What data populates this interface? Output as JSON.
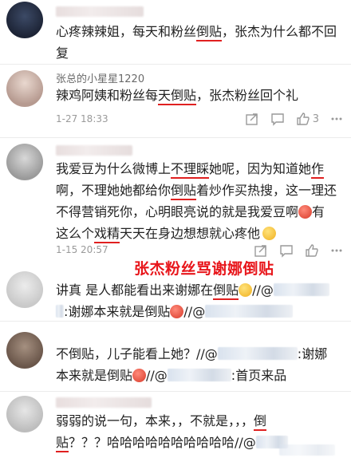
{
  "comments": [
    {
      "author": "",
      "text_parts": [
        "心疼辣辣姐，每天和粉丝",
        "倒贴",
        "，张杰为什么都不回复"
      ],
      "time": "",
      "like_count": ""
    },
    {
      "author": "张总的小星星1220",
      "text_parts": [
        "辣鸡阿姨和粉丝每",
        "天倒贴",
        "，张杰粉丝回个礼"
      ],
      "time": "1-27 18:33",
      "like_count": "3"
    },
    {
      "author": "",
      "text": "我爱豆为什么微博上不理睬她呢，因为知道她作啊，不理她她都给你倒贴着炒作买热搜，这一理还不得营销死你，心明眼亮说的就是我爱豆啊",
      "line1": [
        "我爱豆为什么微博上",
        "不理睬",
        "她呢，因为知道她",
        "作"
      ],
      "line2": [
        "啊，不理她她都给你",
        "倒贴",
        "着炒作买热搜，这一理还"
      ],
      "line3": [
        "不得营销死你，心明眼亮说的就是我爱豆啊",
        "有"
      ],
      "line4": [
        "这么个",
        "戏精",
        "天天在身边想想就心疼他"
      ],
      "time": "1-15 20:57",
      "like_count": ""
    }
  ],
  "headline": "张杰粉丝骂谢娜倒贴",
  "replies": [
    {
      "line1": [
        "讲真 是人都能看出来谢娜在",
        "倒贴",
        "//@"
      ],
      "line2": [
        ":谢娜本来就是倒贴",
        "//@"
      ]
    },
    {
      "line1": [
        "不倒贴，儿子能看上她？//@",
        ":谢娜"
      ],
      "line2": [
        "本来就是倒贴",
        "//@",
        ":首页来品"
      ]
    },
    {
      "line1": [
        "弱弱的说一句，本来，，不就是，，，",
        "倒"
      ],
      "line2": [
        "贴",
        "？？？哈哈哈哈哈哈哈哈哈哈//@"
      ]
    }
  ],
  "icons": {
    "share": "share-icon",
    "comment": "comment-icon",
    "like": "thumbs-up-icon"
  },
  "colors": {
    "highlight_underline": "#e02020",
    "headline": "#e8161b"
  }
}
